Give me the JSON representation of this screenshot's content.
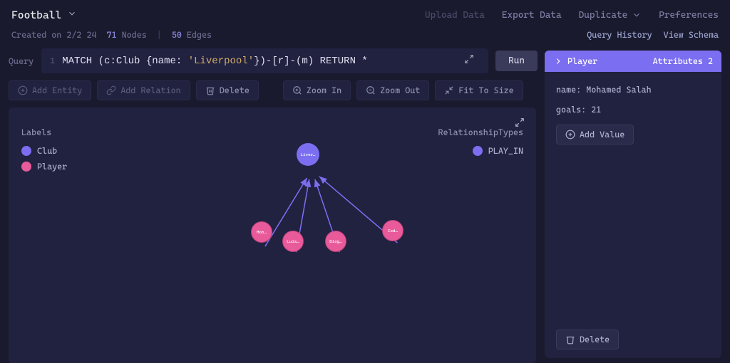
{
  "header": {
    "title": "Football",
    "upload": "Upload Data",
    "export": "Export Data",
    "duplicate": "Duplicate",
    "preferences": "Preferences"
  },
  "meta": {
    "created_label": "Created on",
    "created_date": "2/2 24",
    "nodes_count": "71",
    "nodes_label": "Nodes",
    "edges_count": "50",
    "edges_label": "Edges",
    "query_history": "Query History",
    "view_schema": "View Schema"
  },
  "query": {
    "label": "Query",
    "line": "1",
    "kw_match": "MATCH ",
    "open1": "(",
    "var_c": "c",
    "colon1": ":",
    "type_club": "Club ",
    "brace_open": "{",
    "prop_name": "name",
    "colon2": ": ",
    "str_val": "'Liverpool'",
    "brace_close": "}",
    "close1": ")",
    "dash1": "-",
    "open_r": "[",
    "var_r": "r",
    "close_r": "]",
    "dash2": "-",
    "open_m": "(",
    "var_m": "m",
    "close_m": ") ",
    "kw_return": "RETURN ",
    "star": "*",
    "run": "Run"
  },
  "toolbar": {
    "add_entity": "Add Entity",
    "add_relation": "Add Relation",
    "delete": "Delete",
    "zoom_in": "Zoom In",
    "zoom_out": "Zoom Out",
    "fit": "Fit To Size"
  },
  "canvas": {
    "labels_title": "Labels",
    "label_club": "Club",
    "label_player": "Player",
    "rel_title": "RelationshipTypes",
    "rel_playin": "PLAY_IN",
    "node_liverpool": "Liver…",
    "node_moh": "Moh…",
    "node_luis": "Luis…",
    "node_diog": "Diog…",
    "node_cod": "Cod…"
  },
  "panel": {
    "title": "Player",
    "attrs_label": "Attributes 2",
    "attr_name": "name: Mohamed Salah",
    "attr_goals": "goals: 21",
    "add_value": "Add Value",
    "delete": "Delete"
  }
}
